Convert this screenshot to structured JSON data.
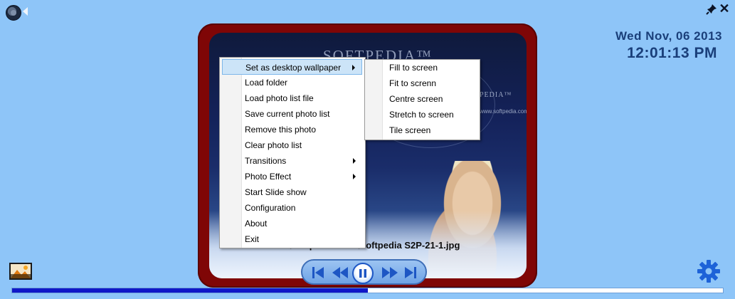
{
  "clock": {
    "date": "Wed Nov, 06 2013",
    "time": "12:01:13 PM"
  },
  "photo": {
    "filename": "...\\Softpedia Files\\Softpedia S2P-21-1.jpg",
    "watermark": "SOFTPEDIA™",
    "watermark_small": "PEDIA™",
    "watermark_url": "www.softpedia.com"
  },
  "context_menu": {
    "items": [
      {
        "label": "Set as desktop wallpaper",
        "submenu": true,
        "highlighted": true
      },
      {
        "label": "Load folder",
        "submenu": false
      },
      {
        "label": "Load photo list file",
        "submenu": false
      },
      {
        "label": "Save current photo list",
        "submenu": false
      },
      {
        "label": "Remove this photo",
        "submenu": false
      },
      {
        "label": "Clear photo list",
        "submenu": false
      },
      {
        "label": "Transitions",
        "submenu": true
      },
      {
        "label": "Photo Effect",
        "submenu": true
      },
      {
        "label": "Start Slide show",
        "submenu": false
      },
      {
        "label": "Configuration",
        "submenu": false
      },
      {
        "label": "About",
        "submenu": false
      },
      {
        "label": "Exit",
        "submenu": false
      }
    ]
  },
  "wallpaper_submenu": {
    "items": [
      {
        "label": "Fill to screen"
      },
      {
        "label": "Fit to screnn"
      },
      {
        "label": "Centre screen"
      },
      {
        "label": "Stretch to screen"
      },
      {
        "label": "Tile screen"
      }
    ]
  },
  "playback": {
    "progress_fraction": 0.5
  },
  "icons": {
    "speaker": "speaker-icon",
    "collapse": "chevron-left-icon",
    "pin": "pin-icon",
    "close": "close-icon",
    "photo": "photo-icon",
    "settings": "gear-icon",
    "first": "skip-first-icon",
    "rewind": "rewind-icon",
    "pause": "pause-icon",
    "forward": "fast-forward-icon",
    "last": "skip-last-icon"
  },
  "colors": {
    "background": "#8ec5f8",
    "frame": "#7f0606",
    "clock_text": "#1a3f7a",
    "progress_fill": "#1018c8",
    "menu_highlight": "#cce4f8"
  }
}
